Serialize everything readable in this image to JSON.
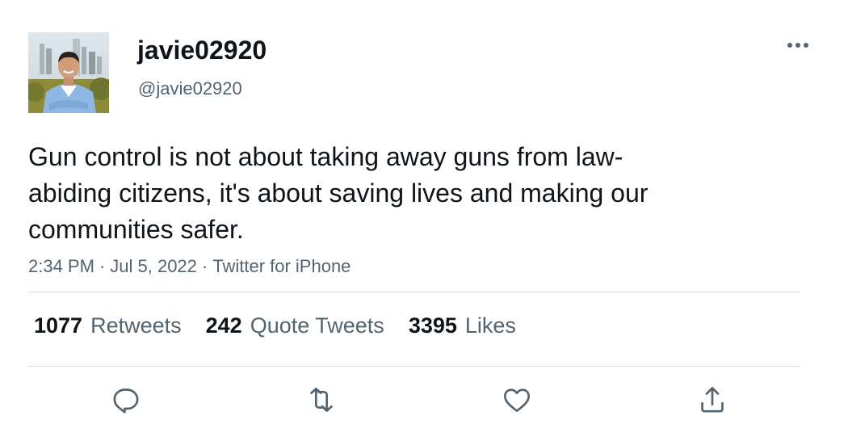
{
  "user": {
    "display_name": "javie02920",
    "handle": "@javie02920",
    "avatar": "profile-photo"
  },
  "tweet": {
    "text": "Gun control is not about taking away guns from law-abiding citizens, it's about saving lives and making our communities safer.",
    "time": "2:34 PM",
    "date": "Jul 5, 2022",
    "source": "Twitter for iPhone",
    "separator": "·"
  },
  "stats": {
    "retweets": {
      "count": "1077",
      "label": "Retweets"
    },
    "quote_tweets": {
      "count": "242",
      "label": "Quote Tweets"
    },
    "likes": {
      "count": "3395",
      "label": "Likes"
    }
  },
  "actions": [
    {
      "icon": "reply-icon"
    },
    {
      "icon": "retweet-icon"
    },
    {
      "icon": "like-icon"
    },
    {
      "icon": "share-icon"
    }
  ],
  "menu": {
    "icon": "more-options-icon"
  },
  "colors": {
    "text_primary": "#0f1419",
    "text_secondary": "#536471",
    "divider": "#d6dbdf",
    "icon": "#536471"
  }
}
